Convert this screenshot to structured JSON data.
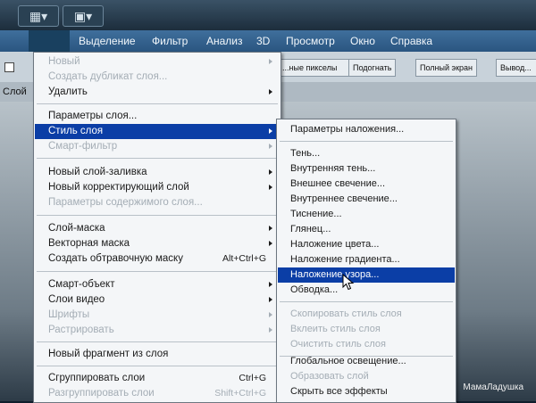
{
  "menubar": {
    "items": [
      "Выделение",
      "Фильтр",
      "Анализ",
      "3D",
      "Просмотр",
      "Окно",
      "Справка"
    ]
  },
  "options_bar": {
    "btn_pixels": "...ные пикселы",
    "btn_fit": "Подогнать",
    "btn_full": "Полный экран",
    "btn_print": "Вывод..."
  },
  "panel": {
    "label": "Слой"
  },
  "layer_menu": {
    "items": [
      {
        "label": "Новый",
        "shortcut": "",
        "submenu": true,
        "disabled": true
      },
      {
        "label": "Создать дубликат слоя...",
        "shortcut": "",
        "submenu": false,
        "disabled": true
      },
      {
        "label": "Удалить",
        "shortcut": "",
        "submenu": true,
        "disabled": false
      },
      {
        "label": "Параметры слоя...",
        "shortcut": "",
        "submenu": false,
        "disabled": false
      },
      {
        "label": "Стиль слоя",
        "shortcut": "",
        "submenu": true,
        "disabled": false,
        "highlighted": true
      },
      {
        "label": "Смарт-фильтр",
        "shortcut": "",
        "submenu": true,
        "disabled": true
      },
      {
        "label": "Новый слой-заливка",
        "shortcut": "",
        "submenu": true,
        "disabled": false
      },
      {
        "label": "Новый корректирующий слой",
        "shortcut": "",
        "submenu": true,
        "disabled": false
      },
      {
        "label": "Параметры содержимого слоя...",
        "shortcut": "",
        "submenu": false,
        "disabled": true
      },
      {
        "label": "Слой-маска",
        "shortcut": "",
        "submenu": true,
        "disabled": false
      },
      {
        "label": "Векторная маска",
        "shortcut": "",
        "submenu": true,
        "disabled": false
      },
      {
        "label": "Создать обтравочную маску",
        "shortcut": "Alt+Ctrl+G",
        "submenu": false,
        "disabled": false
      },
      {
        "label": "Смарт-объект",
        "shortcut": "",
        "submenu": true,
        "disabled": false
      },
      {
        "label": "Слои видео",
        "shortcut": "",
        "submenu": true,
        "disabled": false
      },
      {
        "label": "Шрифты",
        "shortcut": "",
        "submenu": true,
        "disabled": true
      },
      {
        "label": "Растрировать",
        "shortcut": "",
        "submenu": true,
        "disabled": true
      },
      {
        "label": "Новый фрагмент из слоя",
        "shortcut": "",
        "submenu": false,
        "disabled": false
      },
      {
        "label": "Сгруппировать слои",
        "shortcut": "Ctrl+G",
        "submenu": false,
        "disabled": false
      },
      {
        "label": "Разгруппировать слои",
        "shortcut": "Shift+Ctrl+G",
        "submenu": false,
        "disabled": true
      }
    ]
  },
  "style_submenu": {
    "items": [
      {
        "label": "Параметры наложения...",
        "disabled": false
      },
      {
        "label": "Тень...",
        "disabled": false
      },
      {
        "label": "Внутренняя тень...",
        "disabled": false
      },
      {
        "label": "Внешнее свечение...",
        "disabled": false
      },
      {
        "label": "Внутреннее свечение...",
        "disabled": false
      },
      {
        "label": "Тиснение...",
        "disabled": false
      },
      {
        "label": "Глянец...",
        "disabled": false
      },
      {
        "label": "Наложение цвета...",
        "disabled": false
      },
      {
        "label": "Наложение градиента...",
        "disabled": false
      },
      {
        "label": "Наложение узора...",
        "disabled": false,
        "highlighted": true
      },
      {
        "label": "Обводка...",
        "disabled": false
      },
      {
        "label": "Скопировать стиль слоя",
        "disabled": true
      },
      {
        "label": "Вклеить стиль слоя",
        "disabled": true
      },
      {
        "label": "Очистить стиль слоя",
        "disabled": true
      },
      {
        "label": "Глобальное освещение...",
        "disabled": false
      },
      {
        "label": "Образовать слой",
        "disabled": true
      },
      {
        "label": "Скрыть все эффекты",
        "disabled": false
      }
    ]
  },
  "watermark": "МамаЛадушка",
  "colors": {
    "highlight": "#0b3ea6",
    "menu_bg": "#f4f6f8",
    "disabled": "#a4adb5"
  }
}
